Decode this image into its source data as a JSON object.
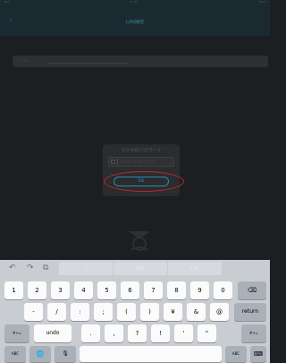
{
  "status_bar": {
    "left": "iPad",
    "time": "11:59",
    "right": "100%"
  },
  "nav": {
    "back": "‹",
    "title": "LAN接続"
  },
  "search": {
    "placeholder": "アカ名..."
  },
  "dialog": {
    "title": "カメラのパスワード",
    "password_placeholder": "パスワードを入力して",
    "ok_label": "Ok"
  },
  "keyboard": {
    "toolbar": {
      "undo_icon": "undo-icon",
      "redo_icon": "redo-icon",
      "paste_icon": "paste-icon",
      "suggestions": [
        "I",
        "the",
        "I'm"
      ]
    },
    "row1": [
      "1",
      "2",
      "3",
      "4",
      "5",
      "6",
      "7",
      "8",
      "9",
      "0"
    ],
    "delete": "⌫",
    "row2": [
      "-",
      "/",
      ":",
      ";",
      "(",
      ")",
      "¥",
      "&",
      "@"
    ],
    "return": "return",
    "row3_left": "#+=",
    "undo": "undo",
    "row3": [
      ".",
      ",",
      "?",
      "!",
      "'",
      "\""
    ],
    "row3_right": "#+=",
    "abc": "ABC",
    "globe": "🌐",
    "mic": "🎙",
    "abc_right": "ABC",
    "hide": "⌨"
  },
  "colors": {
    "accent": "#2d8eb5",
    "highlight_ring": "#c4252f"
  }
}
